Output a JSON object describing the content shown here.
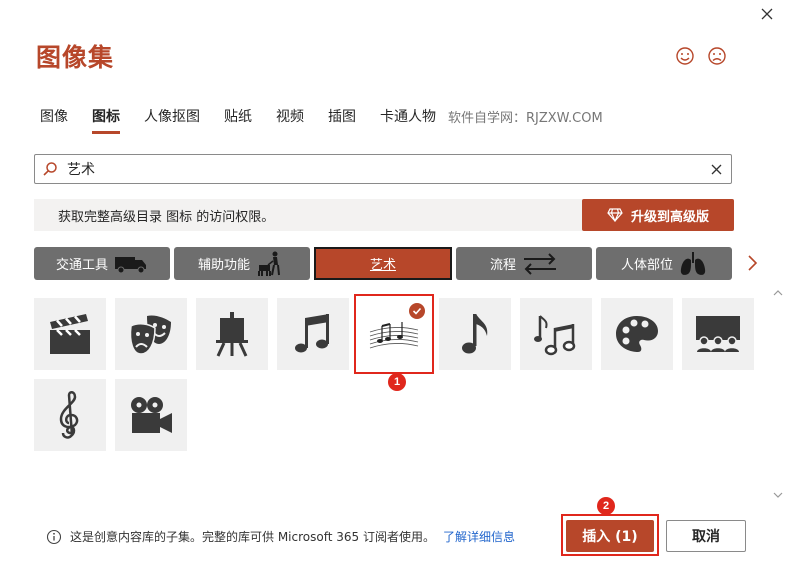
{
  "dialog": {
    "title": "图像集"
  },
  "tabs": [
    {
      "label": "图像",
      "active": false
    },
    {
      "label": "图标",
      "active": true
    },
    {
      "label": "人像抠图",
      "active": false
    },
    {
      "label": "贴纸",
      "active": false
    },
    {
      "label": "视频",
      "active": false
    },
    {
      "label": "插图",
      "active": false
    },
    {
      "label": "卡通人物",
      "active": false
    }
  ],
  "watermark": "软件自学网：RJZXW.COM",
  "search": {
    "value": "艺术",
    "placeholder": ""
  },
  "promo": {
    "text": "获取完整高级目录 图标 的访问权限。",
    "upgrade_label": "升级到高级版"
  },
  "categories": [
    {
      "label": "交通工具",
      "icon": "truck-icon",
      "active": false
    },
    {
      "label": "辅助功能",
      "icon": "guide-dog-icon",
      "active": false
    },
    {
      "label": "艺术",
      "icon": "",
      "active": true
    },
    {
      "label": "流程",
      "icon": "arrows-exchange-icon",
      "active": false
    },
    {
      "label": "人体部位",
      "icon": "lungs-icon",
      "active": false
    }
  ],
  "icons": [
    {
      "name": "clapperboard-icon",
      "selected": false
    },
    {
      "name": "theater-masks-icon",
      "selected": false
    },
    {
      "name": "easel-icon",
      "selected": false
    },
    {
      "name": "music-notes-icon",
      "selected": false
    },
    {
      "name": "music-staff-icon",
      "selected": true
    },
    {
      "name": "eighth-note-icon",
      "selected": false
    },
    {
      "name": "music-notes-pair-icon",
      "selected": false
    },
    {
      "name": "paint-palette-icon",
      "selected": false
    },
    {
      "name": "theater-audience-icon",
      "selected": false
    },
    {
      "name": "treble-clef-icon",
      "selected": false
    },
    {
      "name": "movie-camera-icon",
      "selected": false
    }
  ],
  "annotations": {
    "badge1": "1",
    "badge2": "2"
  },
  "footer": {
    "info": "这是创意内容库的子集。完整的库可供 Microsoft 365 订阅者使用。",
    "link": "了解详细信息"
  },
  "buttons": {
    "insert": "插入 (1)",
    "cancel": "取消"
  },
  "colors": {
    "accent": "#b7472a",
    "highlight": "#e0271c",
    "category_bg": "#6e6e6e",
    "tile_bg": "#f0f0f0"
  }
}
